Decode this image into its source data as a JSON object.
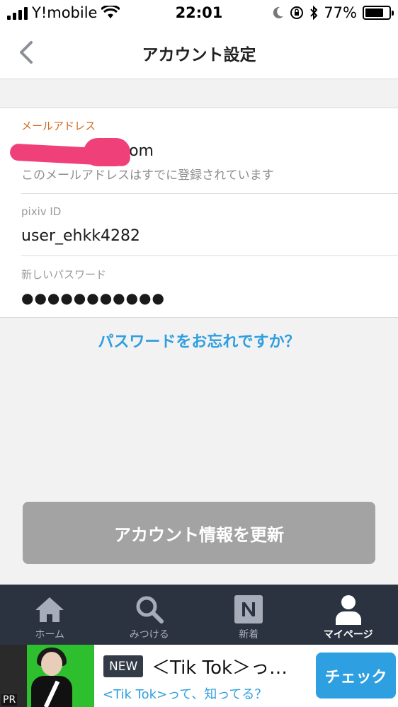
{
  "status_bar": {
    "carrier": "Y!mobile",
    "time": "22:01",
    "battery": "77%",
    "battery_level": 0.77,
    "icons": [
      "signal-icon",
      "wifi-icon",
      "moon-icon",
      "rotation-lock-icon",
      "bluetooth-icon",
      "battery-icon"
    ]
  },
  "nav": {
    "title": "アカウント設定",
    "back_icon": "chevron-left-icon"
  },
  "form": {
    "email": {
      "label": "メールアドレス",
      "value_suffix": "com",
      "hint": "このメールアドレスはすでに登録されています"
    },
    "pixiv_id": {
      "label": "pixiv ID",
      "value": "user_ehkk4282"
    },
    "password": {
      "label": "新しいパスワード",
      "value": "●●●●●●●●●●●"
    }
  },
  "forgot_link": "パスワードをお忘れですか？",
  "update_button": "アカウント情報を更新",
  "tab_bar": {
    "items": [
      {
        "label": "ホーム",
        "icon": "home-icon"
      },
      {
        "label": "みつける",
        "icon": "search-icon"
      },
      {
        "label": "新着",
        "icon": "new-icon"
      },
      {
        "label": "マイページ",
        "icon": "user-icon"
      }
    ],
    "active": "マイページ"
  },
  "ad": {
    "pr": "PR",
    "badge": "NEW",
    "title": "＜Tik Tok＞っ…",
    "subtitle": "<Tik Tok>って、知ってる？",
    "button": "チェック"
  },
  "colors": {
    "accent": "#2e9fe0",
    "label_active": "#d2691e",
    "disabled_button": "#a3a3a3",
    "tab_bar": "#2c3340"
  }
}
